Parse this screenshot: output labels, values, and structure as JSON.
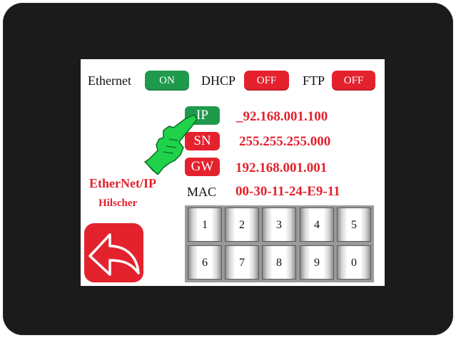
{
  "header": {
    "ethernet_label": "Ethernet",
    "ethernet_state": "ON",
    "dhcp_label": "DHCP",
    "dhcp_state": "OFF",
    "ftp_label": "FTP",
    "ftp_state": "OFF"
  },
  "network": {
    "ip_key": "IP",
    "ip_value": "_92.168.001.100",
    "sn_key": "SN",
    "sn_value": "255.255.255.000",
    "gw_key": "GW",
    "gw_value": "192.168.001.001",
    "mac_label": "MAC",
    "mac_value": "00-30-11-24-E9-11"
  },
  "brand": {
    "line1": "EtherNet/IP",
    "line2": "Hilscher"
  },
  "keypad": {
    "keys": [
      "1",
      "2",
      "3",
      "4",
      "5",
      "6",
      "7",
      "8",
      "9",
      "0"
    ]
  },
  "icons": {
    "back": "back-arrow-icon",
    "pointer": "pointing-hand-icon"
  },
  "colors": {
    "on": "#1f9a4c",
    "off": "#e3222e",
    "value_text": "#e3222e",
    "bezel": "#1b1b1b"
  }
}
